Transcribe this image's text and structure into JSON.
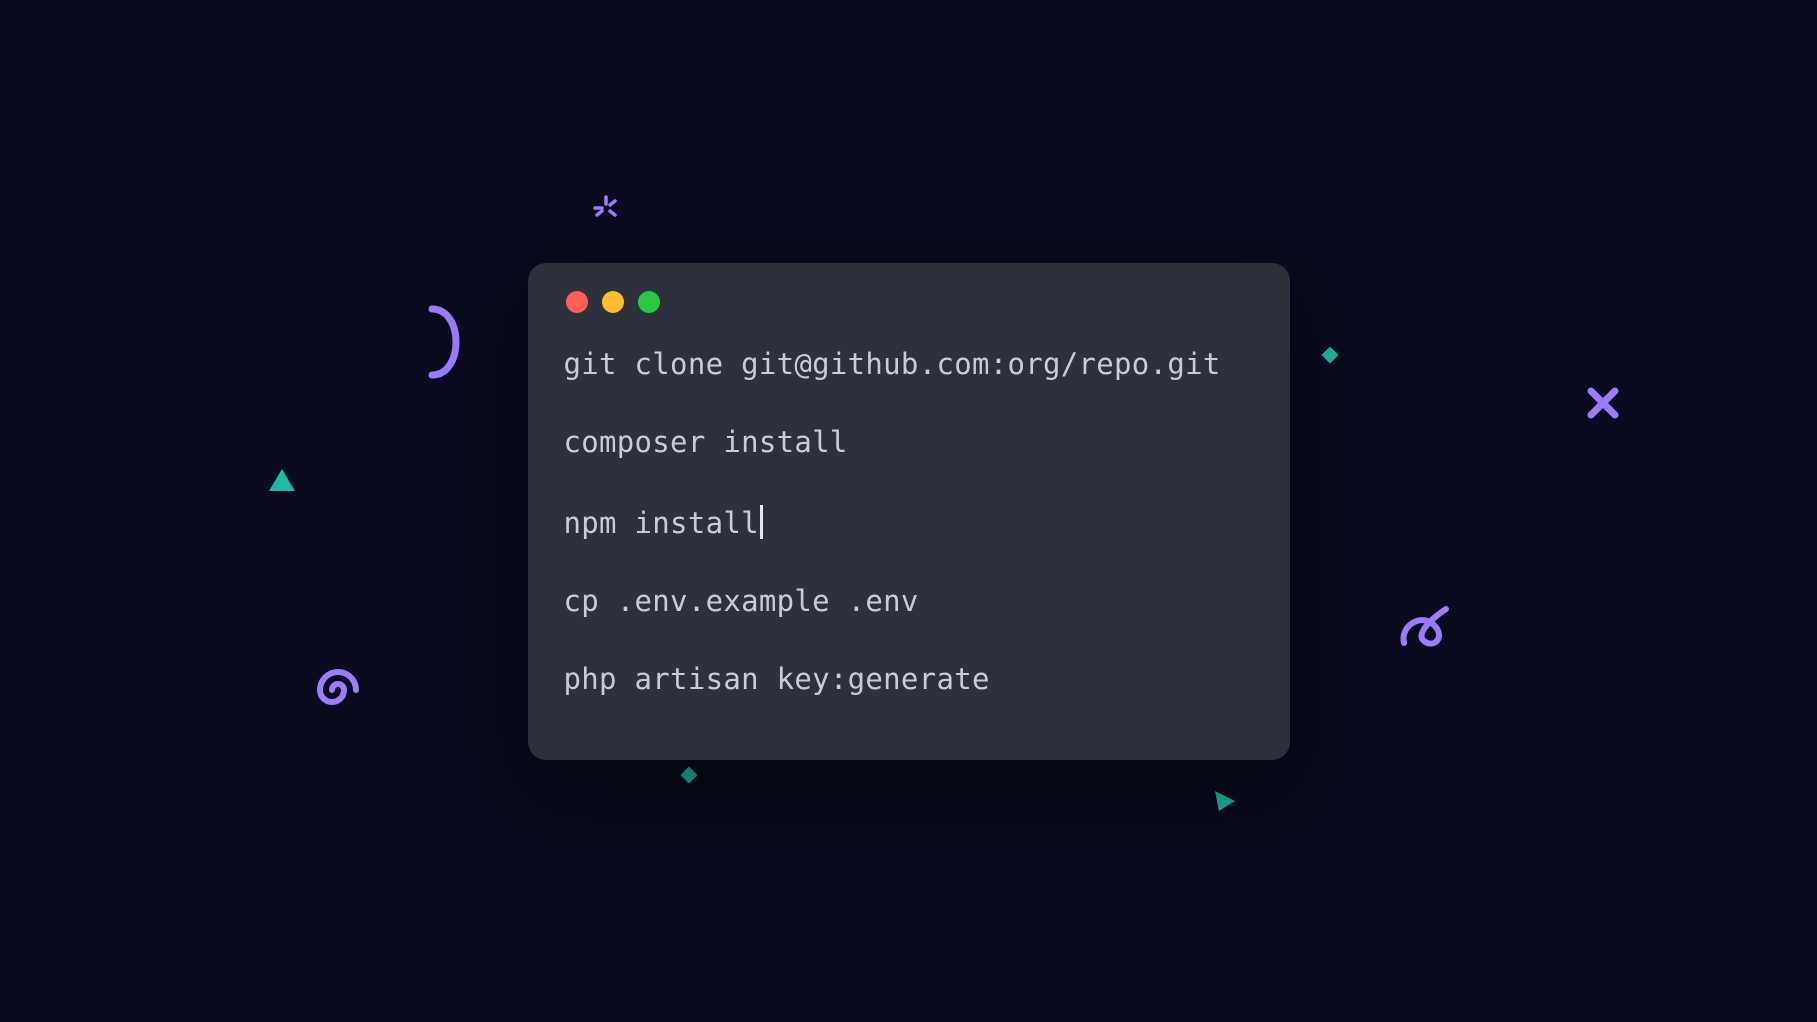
{
  "terminal": {
    "traffic_lights": {
      "close_color": "#ff5f57",
      "minimize_color": "#febc2e",
      "zoom_color": "#28c840"
    },
    "lines": [
      "git clone git@github.com:org/repo.git",
      "composer install",
      "npm install",
      "cp .env.example .env",
      "php artisan key:generate"
    ],
    "cursor_after_line": 2
  },
  "decorations": {
    "spark": "spark-icon",
    "halfcircle": "halfcircle-icon",
    "triangle_up": "triangle-icon",
    "spiral": "spiral-icon",
    "diamond_small": "diamond-icon",
    "diamond_small2": "diamond-icon",
    "triangle_right": "triangle-icon",
    "squiggle": "squiggle-icon",
    "cross": "cross-icon"
  },
  "colors": {
    "background": "#0a0b1e",
    "terminal_bg": "#2c313c",
    "text": "#c7cdd6",
    "purple": "#9d7bff",
    "teal": "#1fb9a8"
  }
}
